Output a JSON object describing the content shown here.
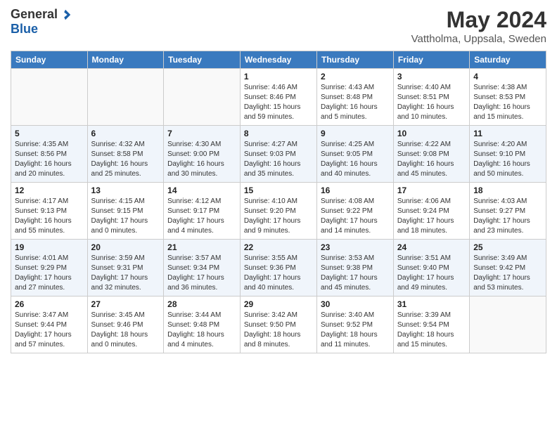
{
  "header": {
    "logo_general": "General",
    "logo_blue": "Blue",
    "month_year": "May 2024",
    "location": "Vattholma, Uppsala, Sweden"
  },
  "days_of_week": [
    "Sunday",
    "Monday",
    "Tuesday",
    "Wednesday",
    "Thursday",
    "Friday",
    "Saturday"
  ],
  "weeks": [
    [
      {
        "num": "",
        "info": ""
      },
      {
        "num": "",
        "info": ""
      },
      {
        "num": "",
        "info": ""
      },
      {
        "num": "1",
        "info": "Sunrise: 4:46 AM\nSunset: 8:46 PM\nDaylight: 15 hours\nand 59 minutes."
      },
      {
        "num": "2",
        "info": "Sunrise: 4:43 AM\nSunset: 8:48 PM\nDaylight: 16 hours\nand 5 minutes."
      },
      {
        "num": "3",
        "info": "Sunrise: 4:40 AM\nSunset: 8:51 PM\nDaylight: 16 hours\nand 10 minutes."
      },
      {
        "num": "4",
        "info": "Sunrise: 4:38 AM\nSunset: 8:53 PM\nDaylight: 16 hours\nand 15 minutes."
      }
    ],
    [
      {
        "num": "5",
        "info": "Sunrise: 4:35 AM\nSunset: 8:56 PM\nDaylight: 16 hours\nand 20 minutes."
      },
      {
        "num": "6",
        "info": "Sunrise: 4:32 AM\nSunset: 8:58 PM\nDaylight: 16 hours\nand 25 minutes."
      },
      {
        "num": "7",
        "info": "Sunrise: 4:30 AM\nSunset: 9:00 PM\nDaylight: 16 hours\nand 30 minutes."
      },
      {
        "num": "8",
        "info": "Sunrise: 4:27 AM\nSunset: 9:03 PM\nDaylight: 16 hours\nand 35 minutes."
      },
      {
        "num": "9",
        "info": "Sunrise: 4:25 AM\nSunset: 9:05 PM\nDaylight: 16 hours\nand 40 minutes."
      },
      {
        "num": "10",
        "info": "Sunrise: 4:22 AM\nSunset: 9:08 PM\nDaylight: 16 hours\nand 45 minutes."
      },
      {
        "num": "11",
        "info": "Sunrise: 4:20 AM\nSunset: 9:10 PM\nDaylight: 16 hours\nand 50 minutes."
      }
    ],
    [
      {
        "num": "12",
        "info": "Sunrise: 4:17 AM\nSunset: 9:13 PM\nDaylight: 16 hours\nand 55 minutes."
      },
      {
        "num": "13",
        "info": "Sunrise: 4:15 AM\nSunset: 9:15 PM\nDaylight: 17 hours\nand 0 minutes."
      },
      {
        "num": "14",
        "info": "Sunrise: 4:12 AM\nSunset: 9:17 PM\nDaylight: 17 hours\nand 4 minutes."
      },
      {
        "num": "15",
        "info": "Sunrise: 4:10 AM\nSunset: 9:20 PM\nDaylight: 17 hours\nand 9 minutes."
      },
      {
        "num": "16",
        "info": "Sunrise: 4:08 AM\nSunset: 9:22 PM\nDaylight: 17 hours\nand 14 minutes."
      },
      {
        "num": "17",
        "info": "Sunrise: 4:06 AM\nSunset: 9:24 PM\nDaylight: 17 hours\nand 18 minutes."
      },
      {
        "num": "18",
        "info": "Sunrise: 4:03 AM\nSunset: 9:27 PM\nDaylight: 17 hours\nand 23 minutes."
      }
    ],
    [
      {
        "num": "19",
        "info": "Sunrise: 4:01 AM\nSunset: 9:29 PM\nDaylight: 17 hours\nand 27 minutes."
      },
      {
        "num": "20",
        "info": "Sunrise: 3:59 AM\nSunset: 9:31 PM\nDaylight: 17 hours\nand 32 minutes."
      },
      {
        "num": "21",
        "info": "Sunrise: 3:57 AM\nSunset: 9:34 PM\nDaylight: 17 hours\nand 36 minutes."
      },
      {
        "num": "22",
        "info": "Sunrise: 3:55 AM\nSunset: 9:36 PM\nDaylight: 17 hours\nand 40 minutes."
      },
      {
        "num": "23",
        "info": "Sunrise: 3:53 AM\nSunset: 9:38 PM\nDaylight: 17 hours\nand 45 minutes."
      },
      {
        "num": "24",
        "info": "Sunrise: 3:51 AM\nSunset: 9:40 PM\nDaylight: 17 hours\nand 49 minutes."
      },
      {
        "num": "25",
        "info": "Sunrise: 3:49 AM\nSunset: 9:42 PM\nDaylight: 17 hours\nand 53 minutes."
      }
    ],
    [
      {
        "num": "26",
        "info": "Sunrise: 3:47 AM\nSunset: 9:44 PM\nDaylight: 17 hours\nand 57 minutes."
      },
      {
        "num": "27",
        "info": "Sunrise: 3:45 AM\nSunset: 9:46 PM\nDaylight: 18 hours\nand 0 minutes."
      },
      {
        "num": "28",
        "info": "Sunrise: 3:44 AM\nSunset: 9:48 PM\nDaylight: 18 hours\nand 4 minutes."
      },
      {
        "num": "29",
        "info": "Sunrise: 3:42 AM\nSunset: 9:50 PM\nDaylight: 18 hours\nand 8 minutes."
      },
      {
        "num": "30",
        "info": "Sunrise: 3:40 AM\nSunset: 9:52 PM\nDaylight: 18 hours\nand 11 minutes."
      },
      {
        "num": "31",
        "info": "Sunrise: 3:39 AM\nSunset: 9:54 PM\nDaylight: 18 hours\nand 15 minutes."
      },
      {
        "num": "",
        "info": ""
      }
    ]
  ]
}
